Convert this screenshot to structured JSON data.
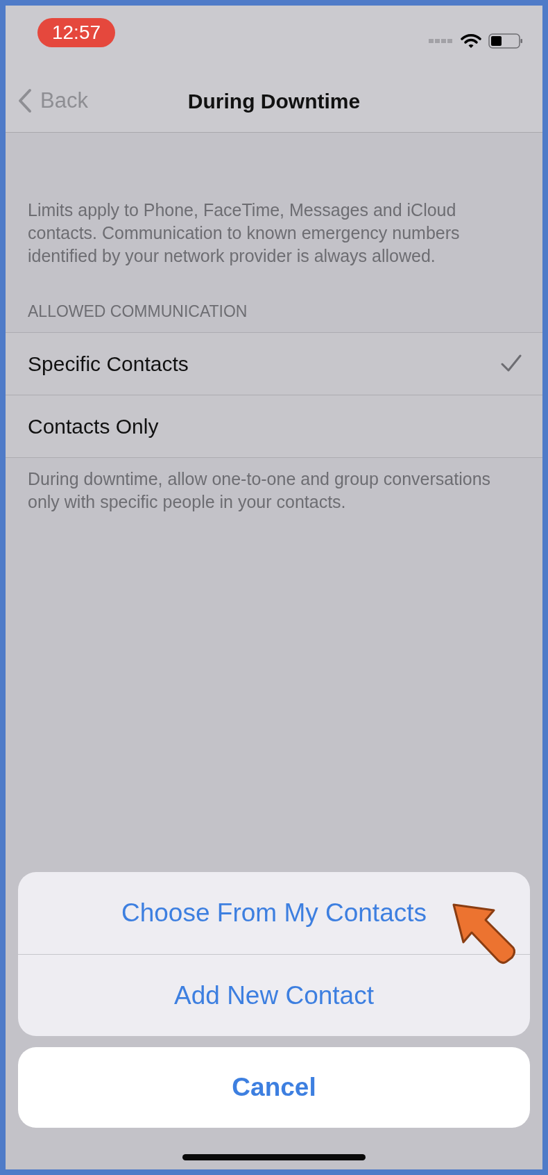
{
  "status_bar": {
    "time": "12:57"
  },
  "nav_bar": {
    "back": "Back",
    "title": "During Downtime"
  },
  "description": "Limits apply to Phone, FaceTime, Messages and iCloud contacts. Communication to known emergency numbers identified by your network provider is always allowed.",
  "section_header": "ALLOWED COMMUNICATION",
  "options": [
    {
      "label": "Specific Contacts",
      "selected": true
    },
    {
      "label": "Contacts Only",
      "selected": false
    }
  ],
  "footer": "During downtime, allow one-to-one and group conversations only with specific people in your contacts.",
  "action_sheet": {
    "actions": [
      "Choose From My Contacts",
      "Add New Contact"
    ],
    "cancel": "Cancel"
  }
}
